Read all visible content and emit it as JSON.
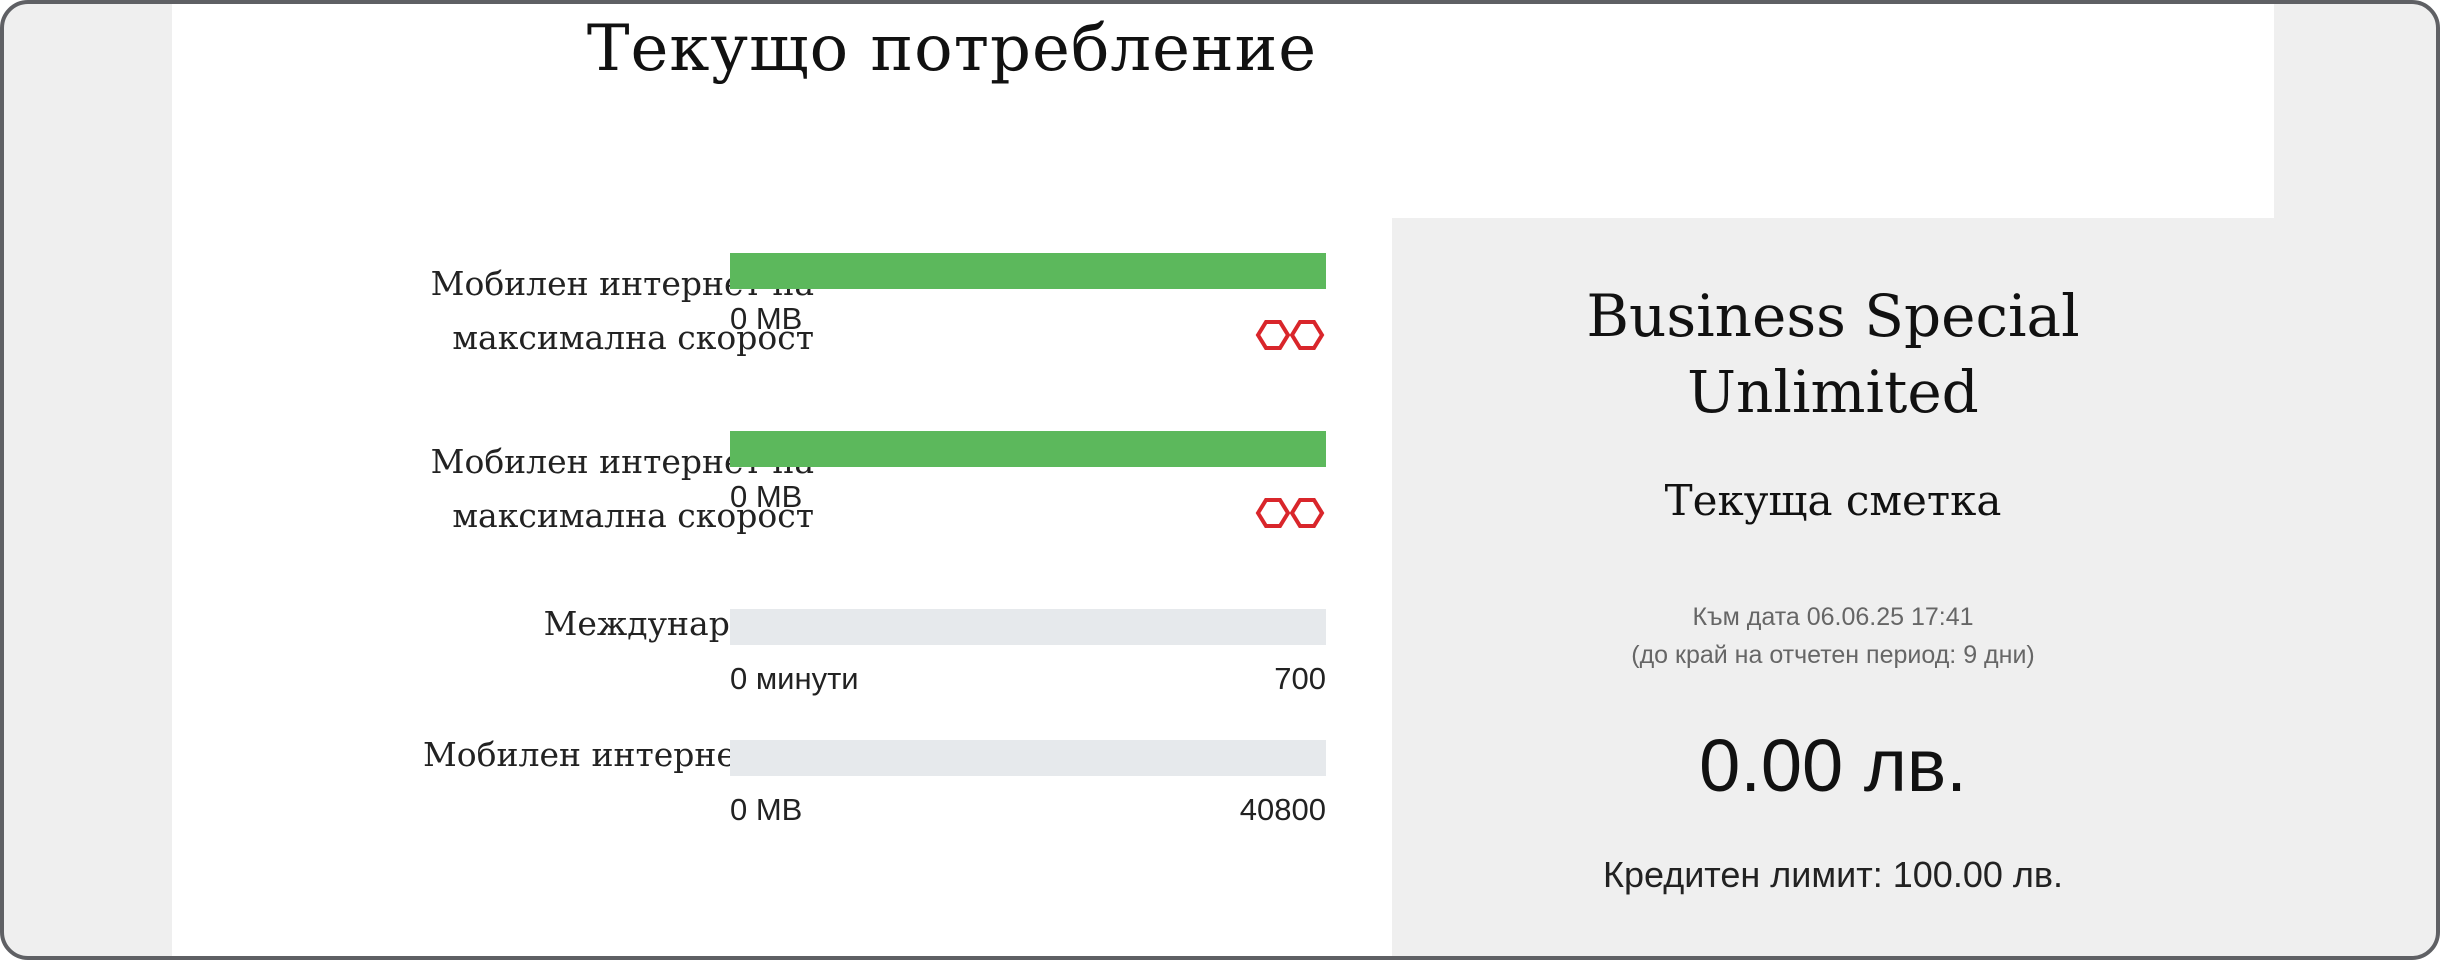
{
  "title": "Текущо потребление",
  "usage": [
    {
      "label_line1": "Мобилен интернет на",
      "label_line2": "максимална скорост",
      "used": "0 MB",
      "total": "",
      "unlimited": true,
      "used_fraction": 1.0,
      "icon": "infinity-icon"
    },
    {
      "label_line1": "Мобилен интернет на",
      "label_line2": "максимална скорост",
      "used": "0 MB",
      "total": "",
      "unlimited": true,
      "used_fraction": 1.0,
      "icon": "infinity-icon"
    },
    {
      "label_line1": "Международни",
      "label_line2": "",
      "used": "0 минути",
      "total": "700",
      "unlimited": false,
      "used_fraction": 0.0
    },
    {
      "label_line1": "Мобилен интернет ЕС",
      "label_line2": "",
      "used": "0 MB",
      "total": "40800",
      "unlimited": false,
      "used_fraction": 0.0
    }
  ],
  "account": {
    "plan_line1": "Business Special",
    "plan_line2": "Unlimited",
    "bill_title": "Текуща сметка",
    "as_of": "Към дата 06.06.25 17:41",
    "period_left": "(до край на отчетен период: 9 дни)",
    "amount": "0.00 лв.",
    "credit_limit": "Кредитен лимит: 100.00 лв."
  },
  "colors": {
    "bar_fill": "#5cb85c",
    "bar_track": "#e6e9ec",
    "icon_red": "#d9262b",
    "panel_bg": "#efefef"
  }
}
